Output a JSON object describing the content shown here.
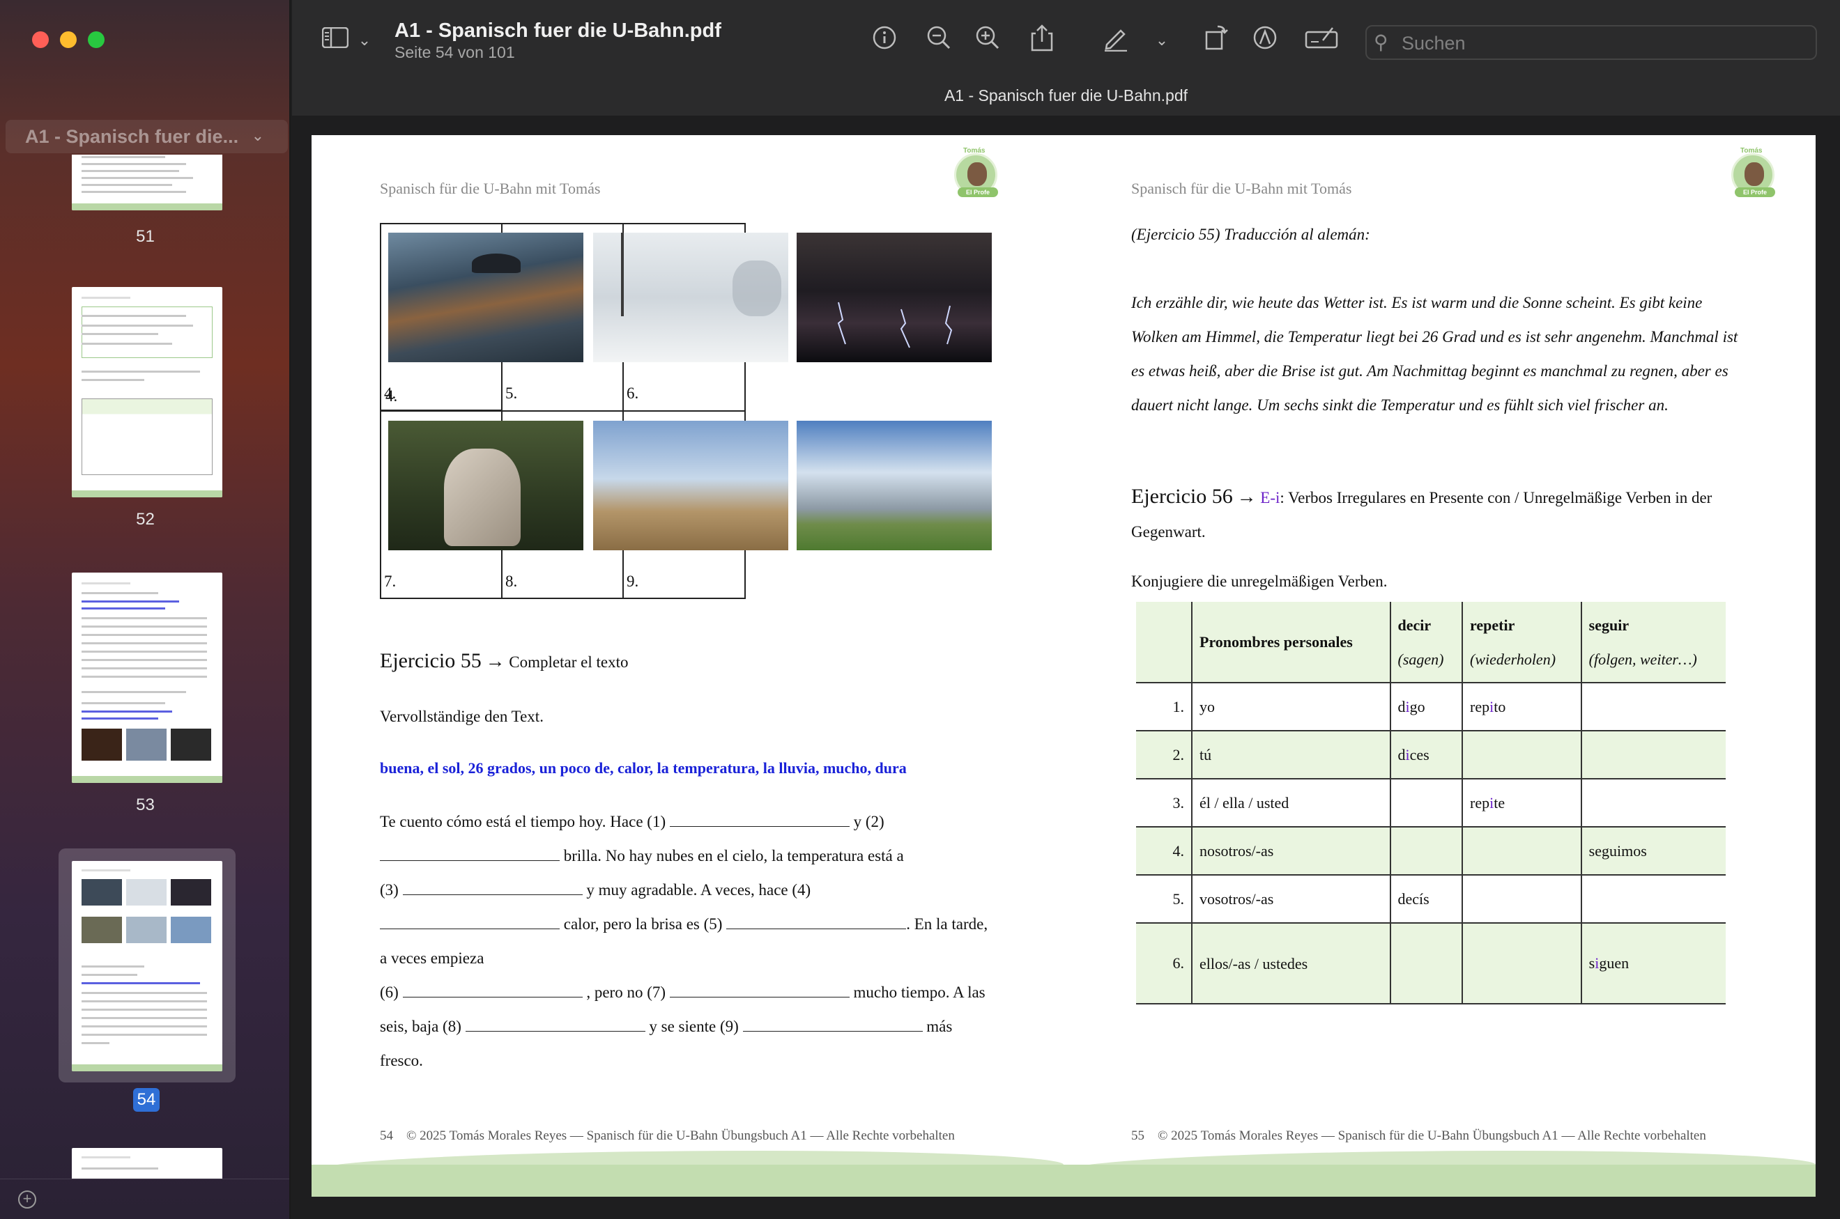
{
  "window": {
    "doc_title": "A1 - Spanisch fuer die U-Bahn.pdf",
    "doc_subtitle": "Seite 54 von 101",
    "tab_title": "A1 - Spanisch fuer die U-Bahn.pdf",
    "search_placeholder": "Suchen"
  },
  "sidebar": {
    "header": "A1 - Spanisch fuer die...",
    "thumbnails": [
      {
        "label": "51"
      },
      {
        "label": "52"
      },
      {
        "label": "53"
      },
      {
        "label": "54",
        "selected": true
      }
    ]
  },
  "toolbar_icons": [
    "sidebar-toggle-icon",
    "chevron-down-icon",
    "info-icon",
    "zoom-out-icon",
    "zoom-in-icon",
    "share-icon",
    "markup-pen-icon",
    "chevron-down-icon",
    "rotate-icon",
    "markup-icon",
    "form-icon",
    "search-icon"
  ],
  "left_page": {
    "header": "Spanisch für die U-Bahn mit Tomás",
    "logo": {
      "top": "Tomás",
      "bottom": "El Profe"
    },
    "images": [
      {
        "num": "4.",
        "desc": "rain-icon"
      },
      {
        "num": "5.",
        "desc": "snow-icon"
      },
      {
        "num": "6.",
        "desc": "storm-icon"
      },
      {
        "num": "7.",
        "desc": "cold-icon"
      },
      {
        "num": "8.",
        "desc": "wind-icon"
      },
      {
        "num": "9.",
        "desc": "clouds-icon"
      }
    ],
    "ex55_title_a": "Ejercicio 55",
    "ex55_title_b": "Completar el texto",
    "ex55_instruction": "Vervollständige den Text.",
    "ex55_words": "buena, el sol, 26 grados, un poco de, calor, la temperatura, la lluvia, mucho, dura",
    "text": {
      "l1a": "Te cuento cómo está el tiempo hoy. Hace (1)",
      "l1b": "y (2)",
      "l2": "brilla.  No hay nubes en el cielo, la temperatura está a",
      "l3a": "(3)",
      "l3b": "y muy agradable. A veces, hace (4)",
      "l4a": "calor, pero la brisa es (5)",
      "l4b": ". En la tarde,",
      "l5": "a veces empieza",
      "l6a": "(6)",
      "l6b": ", pero no (7)",
      "l6c": "mucho tiempo. A las",
      "l7a": "seis, baja (8)",
      "l7b": "y se siente (9)",
      "l7c": "más",
      "l8": "fresco."
    },
    "page_num": "54",
    "footer": "© 2025 Tomás Morales Reyes — Spanisch für die U-Bahn Übungsbuch A1 — Alle Rechte vorbehalten"
  },
  "right_page": {
    "header": "Spanisch für die U-Bahn mit Tomás",
    "logo": {
      "top": "Tomás",
      "bottom": "El Profe"
    },
    "ex55_translation_title": "(Ejercicio 55) Traducción al alemán:",
    "translation": "Ich erzähle dir, wie heute das Wetter ist. Es ist warm und die Sonne scheint. Es gibt keine Wolken am Himmel, die Temperatur liegt bei 26 Grad und es ist sehr angenehm. Manchmal ist es etwas heiß, aber die Brise ist gut. Am Nachmittag beginnt es manchmal zu regnen, aber es dauert nicht lange. Um sechs sinkt die Temperatur und es fühlt sich viel frischer an.",
    "ex56_title_a": "Ejercicio 56",
    "ex56_arrow_tag": "E-i",
    "ex56_title_b": ": Verbos Irregulares en Presente con / Unregelmäßige Verben in der Gegenwart.",
    "ex56_instruction": "Konjugiere die unregelmäßigen Verben.",
    "table": {
      "headers": [
        {
          "main": "Pronombres personales",
          "sub": ""
        },
        {
          "main": "decir",
          "sub": "(sagen)"
        },
        {
          "main": "repetir",
          "sub": "(wiederholen)"
        },
        {
          "main": "seguir",
          "sub": "(folgen, weiter…)"
        }
      ],
      "rows": [
        {
          "n": "1.",
          "p": "yo",
          "decir": "digo",
          "repetir": "repito",
          "seguir": ""
        },
        {
          "n": "2.",
          "p": "tú",
          "decir": "dices",
          "repetir": "",
          "seguir": ""
        },
        {
          "n": "3.",
          "p": "él / ella / usted",
          "decir": "",
          "repetir": "repite",
          "seguir": ""
        },
        {
          "n": "4.",
          "p": "nosotros/-as",
          "decir": "",
          "repetir": "",
          "seguir": "seguimos"
        },
        {
          "n": "5.",
          "p": "vosotros/-as",
          "decir": "decís",
          "repetir": "",
          "seguir": ""
        },
        {
          "n": "6.",
          "p": "ellos/-as / ustedes",
          "decir": "",
          "repetir": "",
          "seguir": "siguen"
        }
      ]
    },
    "page_num": "55",
    "footer": "© 2025 Tomás Morales Reyes — Spanisch für die U-Bahn Übungsbuch A1 — Alle Rechte vorbehalten"
  },
  "colors": {
    "accent_blue": "#1a22d8",
    "accent_purple": "#6b21c8",
    "table_shade": "#eaf5e0",
    "selection": "#2f6fd6"
  }
}
